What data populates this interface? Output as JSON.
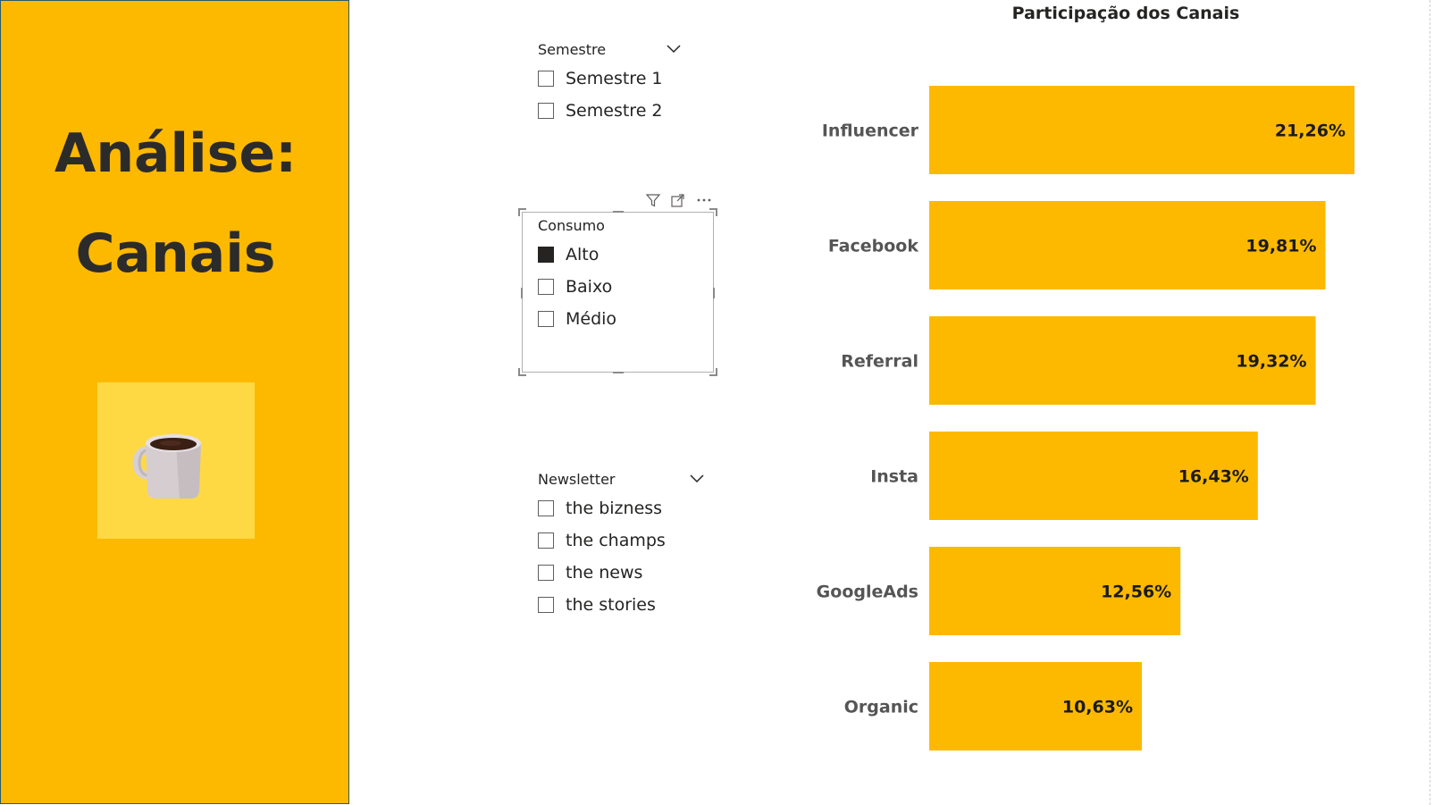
{
  "page": {
    "title_line1": "Análise:",
    "title_line2": "Canais",
    "image_icon": "coffee-mug-icon"
  },
  "slicers": {
    "semestre": {
      "title": "Semestre",
      "items": [
        {
          "label": "Semestre 1",
          "checked": false
        },
        {
          "label": "Semestre 2",
          "checked": false
        }
      ]
    },
    "consumo": {
      "title": "Consumo",
      "items": [
        {
          "label": "Alto",
          "checked": true
        },
        {
          "label": "Baixo",
          "checked": false
        },
        {
          "label": "Médio",
          "checked": false
        }
      ]
    },
    "newsletter": {
      "title": "Newsletter",
      "items": [
        {
          "label": "the bizness",
          "checked": false
        },
        {
          "label": "the champs",
          "checked": false
        },
        {
          "label": "the news",
          "checked": false
        },
        {
          "label": "the stories",
          "checked": false
        }
      ]
    }
  },
  "visual_header_icons": [
    "filter-icon",
    "focus-mode-icon",
    "more-options-icon"
  ],
  "colors": {
    "panel": "#FDB900",
    "bar": "#FDB900",
    "mug_tile": "#FFD944",
    "text": "#252423"
  },
  "chart_data": {
    "type": "bar",
    "orientation": "horizontal",
    "title": "Participação dos Canais",
    "categories": [
      "Influencer",
      "Facebook",
      "Referral",
      "Insta",
      "GoogleAds",
      "Organic"
    ],
    "values": [
      21.26,
      19.81,
      19.32,
      16.43,
      12.56,
      10.63
    ],
    "value_labels": [
      "21,26%",
      "19,81%",
      "19,32%",
      "16,43%",
      "12,56%",
      "10,63%"
    ],
    "xlim": [
      0,
      21.26
    ],
    "xlabel": "",
    "ylabel": "",
    "grid": false,
    "legend": "none"
  }
}
